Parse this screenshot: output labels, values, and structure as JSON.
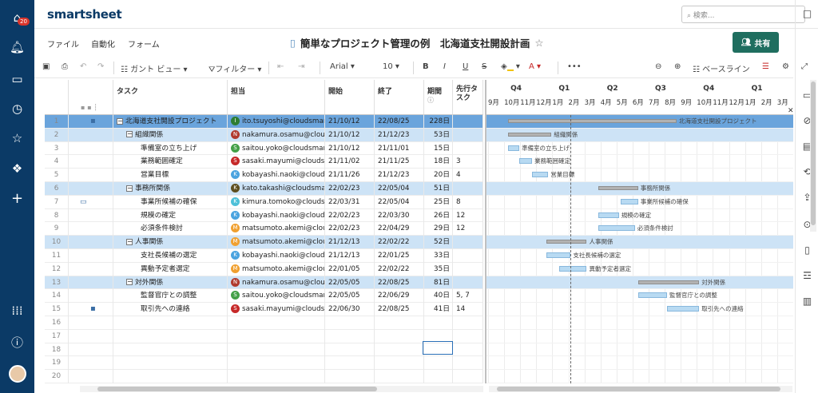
{
  "app": {
    "logo": "smartsheet",
    "notif_count": "20",
    "search_placeholder": "検索..."
  },
  "menu": {
    "file": "ファイル",
    "automation": "自動化",
    "form": "フォーム"
  },
  "doc": {
    "title": "簡単なプロジェクト管理の例　北海道支社開設計画",
    "share": "共有"
  },
  "toolbar": {
    "gantt_view": "ガント ビュー",
    "filter": "フィルター",
    "font": "Arial",
    "size": "10",
    "baseline": "ベースライン"
  },
  "columns": {
    "task": "タスク",
    "assignee": "担当",
    "start": "開始",
    "end": "終了",
    "duration": "期間",
    "predecessor": "先行タスク"
  },
  "gantt_header": {
    "quarters": [
      "Q4",
      "Q1",
      "Q2",
      "Q3",
      "Q4",
      "Q1"
    ],
    "months": [
      "9月",
      "10月",
      "11月",
      "12月",
      "1月",
      "2月",
      "3月",
      "4月",
      "5月",
      "6月",
      "7月",
      "8月",
      "9月",
      "10月",
      "11月",
      "12月",
      "1月",
      "2月",
      "3月"
    ]
  },
  "rows": [
    {
      "num": "1",
      "task": "北海道支社開設プロジェクト",
      "level": 0,
      "parent": true,
      "sel": true,
      "initial": "I",
      "color": "#2e7d32",
      "assignee": "ito.tsuyoshi@cloudsmart",
      "start": "21/10/12",
      "end": "22/08/25",
      "dur": "228日",
      "pred": "",
      "icon": "briefcase",
      "bar_s": 0.0,
      "bar_e": 10.5,
      "bar_label": "北海道支社開設プロジェクト"
    },
    {
      "num": "2",
      "task": "組織関係",
      "level": 1,
      "parent": true,
      "initial": "N",
      "color": "#b03a2e",
      "assignee": "nakamura.osamu@clouds",
      "start": "21/10/12",
      "end": "21/12/23",
      "dur": "53日",
      "pred": "",
      "bar_s": 0.0,
      "bar_e": 2.7,
      "bar_label": "組織関係"
    },
    {
      "num": "3",
      "task": "準備室の立ち上げ",
      "level": 2,
      "initial": "S",
      "color": "#43a047",
      "assignee": "saitou.yoko@cloudsmart",
      "start": "21/10/12",
      "end": "21/11/01",
      "dur": "15日",
      "pred": "",
      "bar_s": 0.0,
      "bar_e": 0.7,
      "bar_label": "準備室の立ち上げ"
    },
    {
      "num": "4",
      "task": "業務範囲確定",
      "level": 2,
      "initial": "S",
      "color": "#c62828",
      "assignee": "sasaki.mayumi@cloudsm",
      "start": "21/11/02",
      "end": "21/11/25",
      "dur": "18日",
      "pred": "3",
      "bar_s": 0.7,
      "bar_e": 1.5,
      "bar_label": "業務範囲確定"
    },
    {
      "num": "5",
      "task": "営業目標",
      "level": 2,
      "initial": "K",
      "color": "#4aa3df",
      "assignee": "kobayashi.naoki@clouds",
      "start": "21/11/26",
      "end": "21/12/23",
      "dur": "20日",
      "pred": "4",
      "bar_s": 1.5,
      "bar_e": 2.5,
      "bar_label": "営業目標"
    },
    {
      "num": "6",
      "task": "事務所関係",
      "level": 1,
      "parent": true,
      "initial": "K",
      "color": "#5d4e1e",
      "assignee": "kato.takashi@cloudsmar",
      "start": "22/02/23",
      "end": "22/05/04",
      "dur": "51日",
      "pred": "",
      "bar_s": 5.6,
      "bar_e": 8.1,
      "bar_label": "事務所関係"
    },
    {
      "num": "7",
      "task": "事業所候補の確保",
      "level": 2,
      "initial": "K",
      "color": "#4ec0d8",
      "assignee": "kimura.tomoko@cloudsm",
      "start": "22/03/31",
      "end": "22/05/04",
      "dur": "25日",
      "pred": "8",
      "comment": true,
      "bar_s": 7.0,
      "bar_e": 8.1,
      "bar_label": "事業所候補の確保"
    },
    {
      "num": "8",
      "task": "規模の確定",
      "level": 2,
      "initial": "K",
      "color": "#4aa3df",
      "assignee": "kobayashi.naoki@clouds",
      "start": "22/02/23",
      "end": "22/03/30",
      "dur": "26日",
      "pred": "12",
      "bar_s": 5.6,
      "bar_e": 6.9,
      "bar_label": "規模の確定"
    },
    {
      "num": "9",
      "task": "必須条件検討",
      "level": 2,
      "initial": "M",
      "color": "#f0a030",
      "assignee": "matsumoto.akemi@clouds",
      "start": "22/02/23",
      "end": "22/04/29",
      "dur": "29日",
      "pred": "12",
      "bar_s": 5.6,
      "bar_e": 7.9,
      "bar_label": "必須条件検討"
    },
    {
      "num": "10",
      "task": "人事関係",
      "level": 1,
      "parent": true,
      "initial": "M",
      "color": "#f0a030",
      "assignee": "matsumoto.akemi@clouds",
      "start": "21/12/13",
      "end": "22/02/22",
      "dur": "52日",
      "pred": "",
      "bar_s": 2.4,
      "bar_e": 4.9,
      "bar_label": "人事関係"
    },
    {
      "num": "11",
      "task": "支社長候補の選定",
      "level": 2,
      "initial": "K",
      "color": "#4aa3df",
      "assignee": "kobayashi.naoki@clouds",
      "start": "21/12/13",
      "end": "22/01/25",
      "dur": "33日",
      "pred": "",
      "bar_s": 2.4,
      "bar_e": 3.9,
      "bar_label": "支社長候補の選定"
    },
    {
      "num": "12",
      "task": "異動予定者選定",
      "level": 2,
      "initial": "M",
      "color": "#f0a030",
      "assignee": "matsumoto.akemi@clouds",
      "start": "22/01/05",
      "end": "22/02/22",
      "dur": "35日",
      "pred": "",
      "bar_s": 3.2,
      "bar_e": 4.9,
      "bar_label": "異動予定者選定"
    },
    {
      "num": "13",
      "task": "対外関係",
      "level": 1,
      "parent": true,
      "initial": "N",
      "color": "#b03a2e",
      "assignee": "nakamura.osamu@clouds",
      "start": "22/05/05",
      "end": "22/08/25",
      "dur": "81日",
      "pred": "",
      "bar_s": 8.1,
      "bar_e": 11.9,
      "bar_label": "対外関係"
    },
    {
      "num": "14",
      "task": "監督官庁との調整",
      "level": 2,
      "initial": "S",
      "color": "#43a047",
      "assignee": "saitou.yoko@cloudsmart",
      "start": "22/05/05",
      "end": "22/06/29",
      "dur": "40日",
      "pred": "5, 7",
      "bar_s": 8.1,
      "bar_e": 9.9,
      "bar_label": "監督官庁との調整"
    },
    {
      "num": "15",
      "task": "取引先への連絡",
      "level": 2,
      "initial": "S",
      "color": "#c62828",
      "assignee": "sasaki.mayumi@cloudsm",
      "start": "22/06/30",
      "end": "22/08/25",
      "dur": "41日",
      "pred": "14",
      "icon": "briefcase",
      "bar_s": 9.9,
      "bar_e": 11.9,
      "bar_label": "取引先への連絡"
    },
    {
      "num": "16"
    },
    {
      "num": "17"
    },
    {
      "num": "18"
    },
    {
      "num": "19"
    },
    {
      "num": "20"
    }
  ]
}
